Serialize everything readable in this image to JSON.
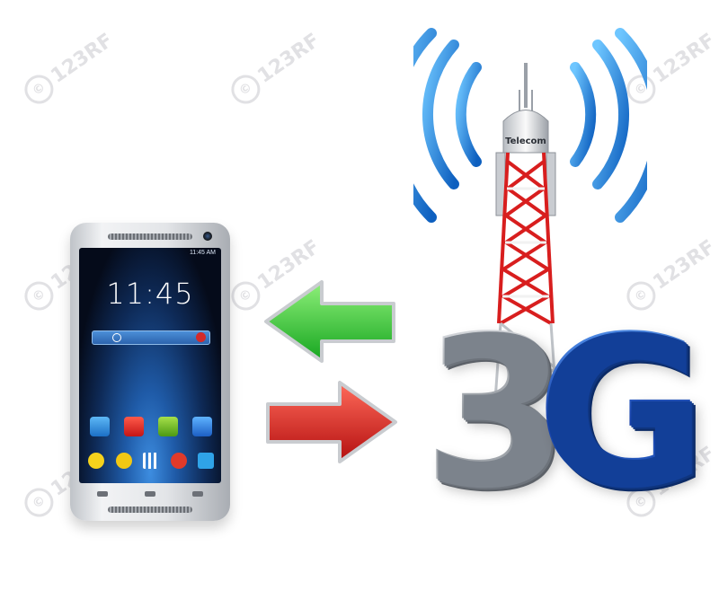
{
  "phone": {
    "clock": "11:45",
    "status_time": "11:45 AM"
  },
  "tower": {
    "label": "Telecom"
  },
  "badge": {
    "text_three": "3",
    "text_g": "G"
  },
  "watermark": {
    "text": "123RF"
  },
  "colors": {
    "arrow_green": "#2fc93a",
    "arrow_red": "#e02424",
    "signal_blue": "#1e8de8",
    "three_silver": "#9aa0a8",
    "g_blue": "#1c56c8",
    "tower_red": "#d81e1e"
  }
}
